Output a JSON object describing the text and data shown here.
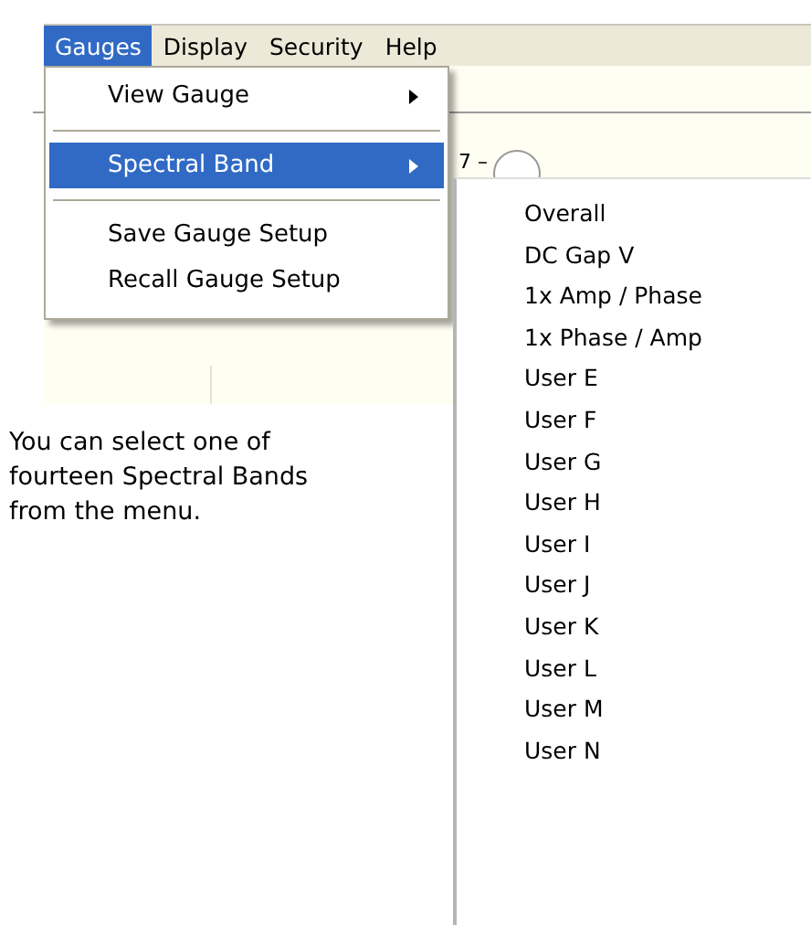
{
  "menu_bar": [
    {
      "label": "Gauges",
      "selected": true
    },
    {
      "label": "Display",
      "selected": false
    },
    {
      "label": "Security",
      "selected": false
    },
    {
      "label": "Help",
      "selected": false
    }
  ],
  "background_panel": {
    "label": "7 –"
  },
  "dropdown": [
    {
      "kind": "item",
      "label": "View Gauge",
      "submenu": true,
      "selected": false
    },
    {
      "kind": "separator"
    },
    {
      "kind": "item",
      "label": "Spectral Band",
      "submenu": true,
      "selected": true
    },
    {
      "kind": "separator"
    },
    {
      "kind": "item",
      "label": "Save Gauge Setup",
      "submenu": false,
      "selected": false
    },
    {
      "kind": "item",
      "label": "Recall Gauge Setup",
      "submenu": false,
      "selected": false
    }
  ],
  "submenu": [
    "Overall",
    "DC Gap V",
    "1x Amp / Phase",
    "1x Phase / Amp",
    "User E",
    "User F",
    "User G",
    "User H",
    "User I",
    "User J",
    "User K",
    "User L",
    "User M",
    "User N"
  ],
  "caption": "You can select one of fourteen Spectral Bands from the menu."
}
